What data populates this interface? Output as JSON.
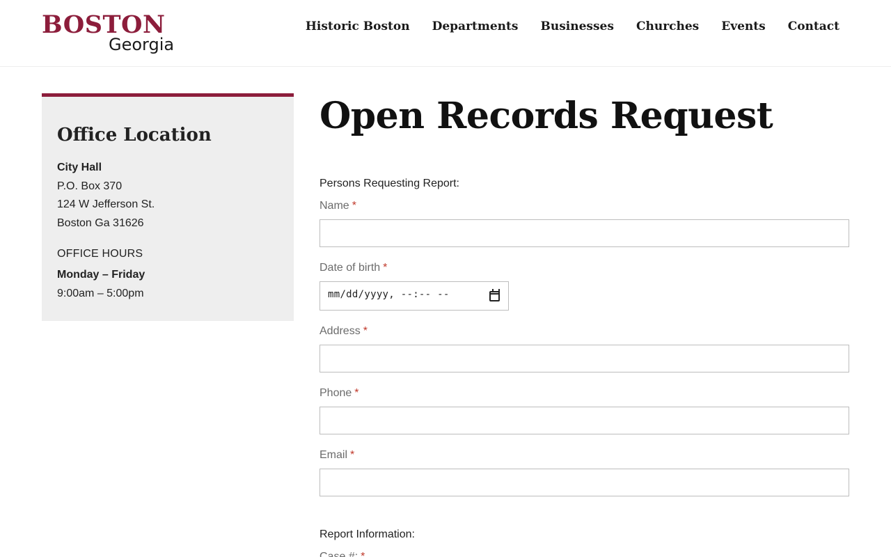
{
  "logo": {
    "top": "BOSTON",
    "bottom": "Georgia"
  },
  "nav": {
    "items": [
      "Historic Boston",
      "Departments",
      "Businesses",
      "Churches",
      "Events",
      "Contact"
    ]
  },
  "sidebar": {
    "title": "Office Location",
    "building": "City Hall",
    "address_lines": [
      "P.O. Box 370",
      "124 W Jefferson St.",
      "Boston Ga 31626"
    ],
    "hours_title": "OFFICE HOURS",
    "hours_days": "Monday – Friday",
    "hours_time": "9:00am – 5:00pm"
  },
  "main": {
    "title": "Open Records Request",
    "section_persons": "Persons Requesting Report:",
    "fields": {
      "name": {
        "label": "Name",
        "value": ""
      },
      "dob": {
        "label": "Date of birth",
        "placeholder": "mm/dd/yyyy, --:-- --"
      },
      "address": {
        "label": "Address",
        "value": ""
      },
      "phone": {
        "label": "Phone",
        "value": ""
      },
      "email": {
        "label": "Email",
        "value": ""
      },
      "case": {
        "label": "Case #:"
      }
    },
    "section_report": "Report Information:",
    "required_marker": "*"
  },
  "colors": {
    "brand": "#8c1d3b",
    "required": "#c0392b"
  },
  "icons": {
    "date_picker": "calendar-icon"
  }
}
